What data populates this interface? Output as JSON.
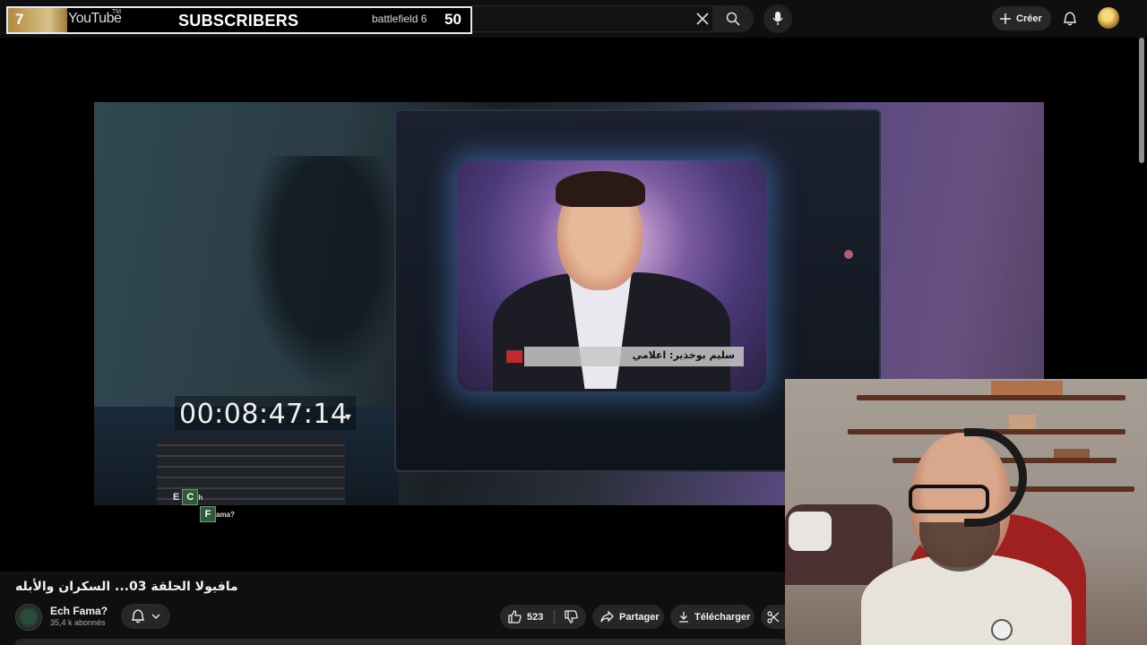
{
  "overlay": {
    "subscriber_count": "7",
    "platform": "YouTube",
    "trademark": "TM",
    "label": "SUBSCRIBERS",
    "goal_name": "battlefield 6",
    "goal": "50"
  },
  "header": {
    "create_label": "Créer",
    "icons": [
      "close-icon",
      "search-icon",
      "mic-icon",
      "plus-icon",
      "bell-icon"
    ]
  },
  "video": {
    "timecode": "00:08:47:14",
    "timecode_marker": "▼",
    "lower_third": "سليم بوخذير: اعلامي",
    "brand": {
      "letter_e": "E",
      "tile_c": "C",
      "suffix_h": "h",
      "tile_f": "F",
      "suffix_ama": "ama?"
    }
  },
  "details": {
    "title": "مافيولا الحلقة 03... السكران والأبله",
    "channel_name": "Ech Fama?",
    "channel_subs": "35,4 k abonnés",
    "like_count": "523",
    "share_label": "Partager",
    "download_label": "Télécharger"
  },
  "colors": {
    "background": "#0f0f0f",
    "pill": "#272727",
    "overlay_gold": "#c9a866"
  }
}
